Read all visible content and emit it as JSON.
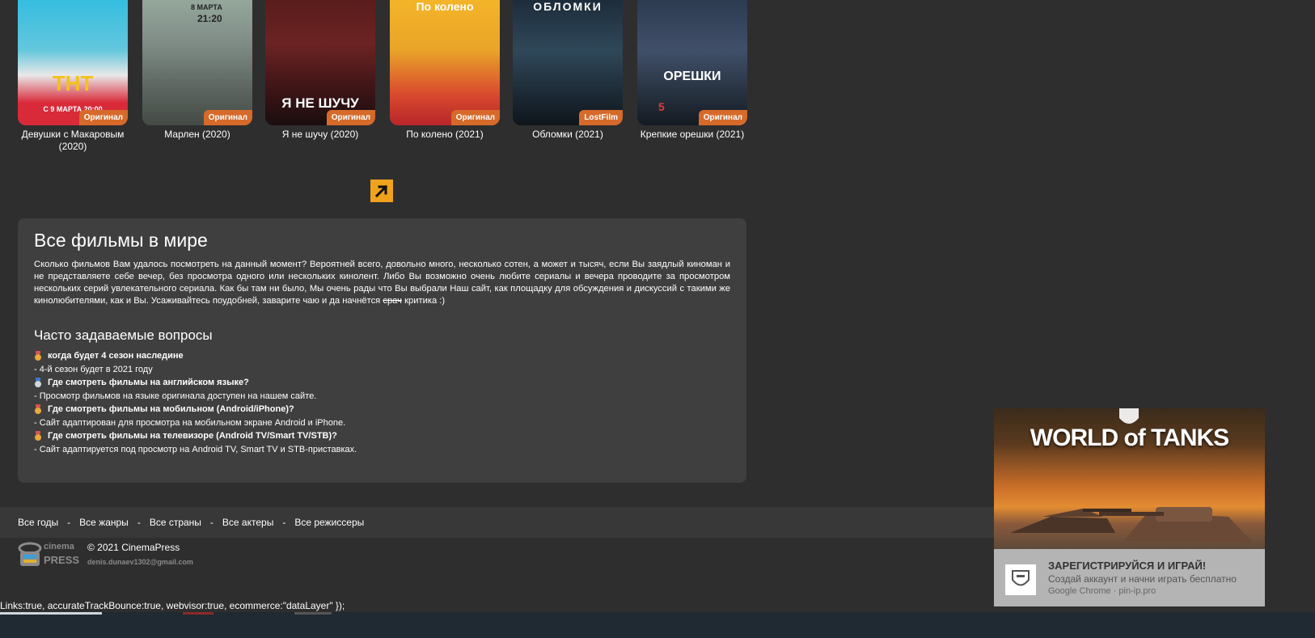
{
  "movies": [
    {
      "title": "Девушки с Макаровым (2020)",
      "badge": "Оригинал",
      "poster_text": "ТНТ",
      "poster_subtext": "С 9 МАРТА 20:00"
    },
    {
      "title": "Марлен (2020)",
      "badge": "Оригинал",
      "poster_text": "8 МАРТА",
      "poster_subtext": "21:20"
    },
    {
      "title": "Я не шучу (2020)",
      "badge": "Оригинал",
      "poster_text": "Я НЕ ШУЧУ",
      "poster_subtext": ""
    },
    {
      "title": "По колено (2021)",
      "badge": "Оригинал",
      "poster_text": "По колено",
      "poster_subtext": ""
    },
    {
      "title": "Обломки (2021)",
      "badge": "LostFilm",
      "poster_text": "ОБЛОМКИ",
      "poster_subtext": ""
    },
    {
      "title": "Крепкие орешки (2021)",
      "badge": "Оригинал",
      "poster_text": "ОРЕШКИ",
      "poster_subtext": "5"
    }
  ],
  "info": {
    "title": "Все фильмы в мире",
    "text_before": "Сколько фильмов Вам удалось посмотреть на данный момент? Вероятней всего, довольно много, несколько сотен, а может и тысяч, если Вы заядлый киноман и не представляете себе вечер, без просмотра одного или нескольких кинолент. Либо Вы возможно очень любите сериалы и вечера проводите за просмотром нескольких серий увлекательного сериала. Как бы там ни было, Мы очень рады что Вы выбрали Наш сайт, как площадку для обсуждения и дискуссий с такими же кинолюбителями, как и Вы. Усаживайтесь поудобней, заварите чаю и да начнётся ",
    "text_strike": "срач",
    "text_after": " критика :)",
    "faq_title": "Часто задаваемые вопросы",
    "faq": [
      {
        "q": "когда будет 4 сезон наследине",
        "a": "- 4-й сезон будет в 2021 году"
      },
      {
        "q": "Где смотреть фильмы на английском языке?",
        "a": "- Просмотр фильмов на языке оригинала доступен на нашем сайте."
      },
      {
        "q": "Где смотреть фильмы на мобильном (Android/iPhone)?",
        "a": "- Сайт адаптирован для просмотра на мобильном экране Android и iPhone."
      },
      {
        "q": "Где смотреть фильмы на телевизоре (Android TV/Smart TV/STB)?",
        "a": "- Сайт адаптируется под просмотр на Android TV, Smart TV и STB-приставках."
      }
    ]
  },
  "footer": {
    "links": [
      "Все годы",
      "Все жанры",
      "Все страны",
      "Все актеры",
      "Все режиссеры"
    ],
    "separator": "-",
    "copyright": "© 2021 CinemaPress",
    "email": "denis.dunaev1302@gmail.com",
    "logo_top": "cinema",
    "logo_bottom": "PRESS"
  },
  "console_text": "Links:true, accurateTrackBounce:true, webvisor:true, ecommerce:\"dataLayer\" });",
  "ad": {
    "brand": "WORLD of TANKS",
    "headline": "ЗАРЕГИСТРИРУЙСЯ И ИГРАЙ!",
    "subtitle": "Создай аккаунт и начни играть бесплатно",
    "source": "Google Chrome · pin-ip.pro"
  },
  "colors": {
    "background": "#2e2e2e",
    "panel": "#3f3f3f",
    "badge": "#d66a2a",
    "accent_button": "#f0a21c"
  },
  "icons": {
    "arrow_button": "arrow-up-right-icon",
    "medal": "medal-icon"
  }
}
